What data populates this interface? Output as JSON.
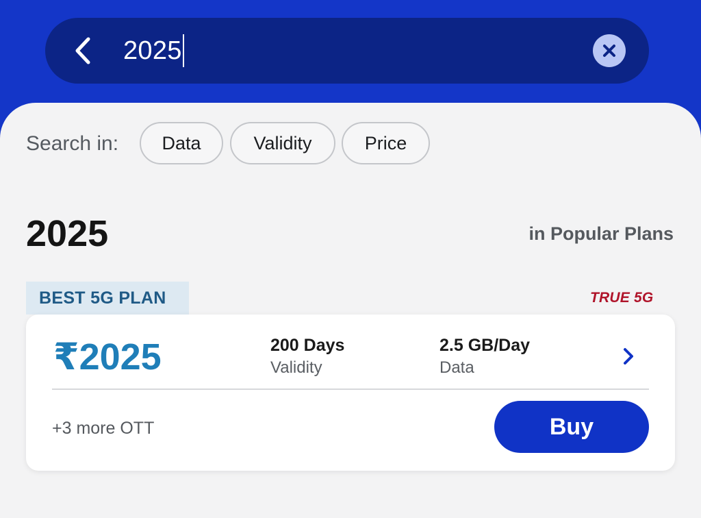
{
  "search": {
    "value": "2025",
    "back_icon": "chevron-left-icon",
    "clear_icon": "close-circle-icon"
  },
  "filters": {
    "label": "Search in:",
    "chips": [
      "Data",
      "Validity",
      "Price"
    ]
  },
  "results": {
    "query": "2025",
    "scope": "in Popular Plans"
  },
  "plan": {
    "badge": "BEST 5G PLAN",
    "network_tag": "TRUE 5G",
    "price": "₹2025",
    "validity_value": "200 Days",
    "validity_label": "Validity",
    "data_value": "2.5 GB/Day",
    "data_label": "Data",
    "ott": "+3 more OTT",
    "buy_label": "Buy",
    "details_icon": "chevron-right-icon"
  },
  "colors": {
    "header_bg": "#1436c8",
    "search_bar_bg": "#0c2486",
    "price": "#1f7eb8",
    "badge_bg": "#dde9f2",
    "badge_text": "#1f5a86",
    "true5g": "#b0142a",
    "buy_button": "#1033c6"
  }
}
